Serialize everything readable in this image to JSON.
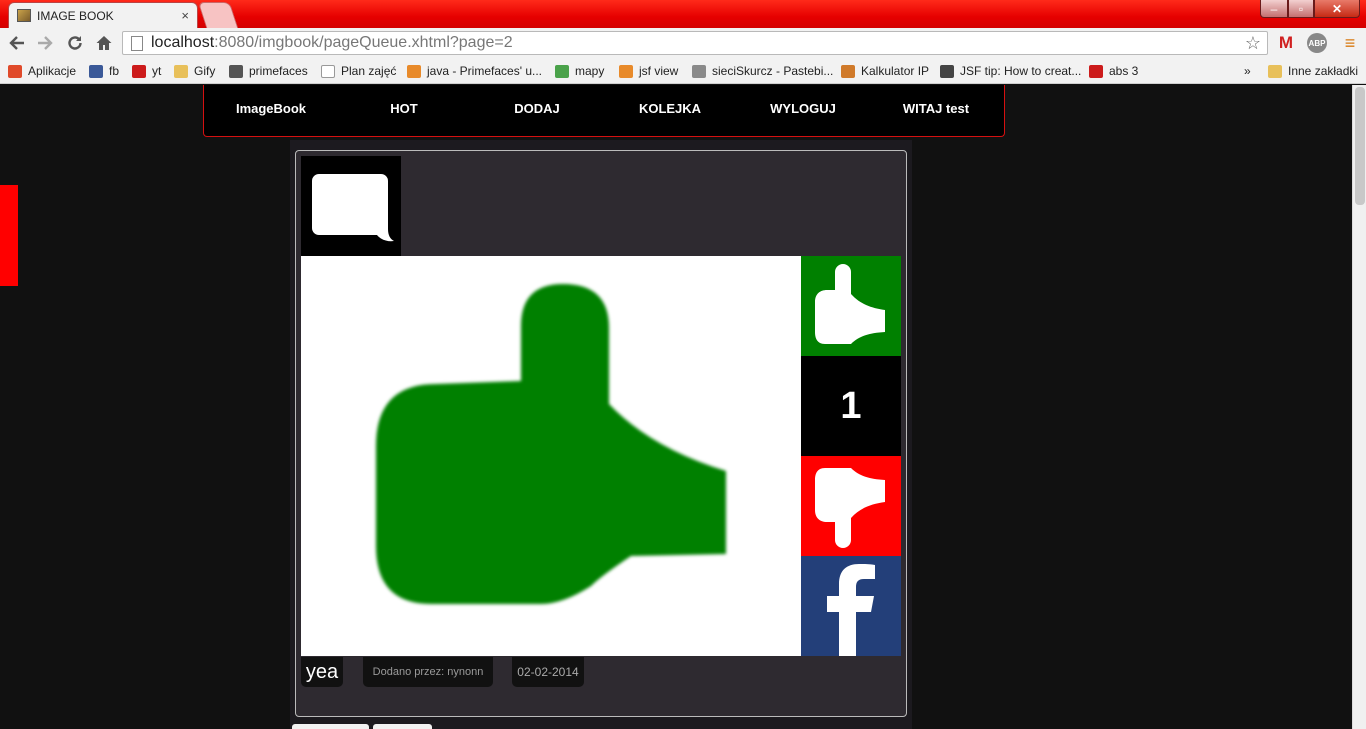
{
  "browser": {
    "tab_title": "IMAGE BOOK",
    "tab_close": "×",
    "url_host": "localhost",
    "url_path": ":8080/imgbook/pageQueue.xhtml?page=2",
    "window_controls": {
      "minimize": "–",
      "maximize": "▫",
      "close": "✕"
    },
    "extensions": {
      "gmail": "M",
      "abp": "ABP"
    },
    "bookmarks": [
      {
        "label": "Aplikacje",
        "icon": "apps-grid-icon",
        "color": "#e04a2a"
      },
      {
        "label": "fb",
        "icon": "facebook-icon",
        "color": "#3b5998"
      },
      {
        "label": "yt",
        "icon": "youtube-icon",
        "color": "#cc1b1b"
      },
      {
        "label": "Gify",
        "icon": "folder-icon",
        "color": "#e8c05a"
      },
      {
        "label": "primefaces",
        "icon": "primefaces-icon",
        "color": "#555555"
      },
      {
        "label": "Plan zajęć",
        "icon": "page-icon",
        "color": "#ffffff"
      },
      {
        "label": "java - Primefaces' u...",
        "icon": "stackoverflow-icon",
        "color": "#e88a2a"
      },
      {
        "label": "mapy",
        "icon": "maps-icon",
        "color": "#4aa24a"
      },
      {
        "label": "jsf view",
        "icon": "stackoverflow-icon",
        "color": "#e88a2a"
      },
      {
        "label": "sieciSkurcz - Pastebi...",
        "icon": "pastebin-icon",
        "color": "#8a8a8a"
      },
      {
        "label": "Kalkulator IP",
        "icon": "network-icon",
        "color": "#d07a2a"
      },
      {
        "label": "JSF tip: How to creat...",
        "icon": "globe-icon",
        "color": "#444444"
      },
      {
        "label": "abs 3",
        "icon": "youtube-icon",
        "color": "#cc1b1b"
      }
    ],
    "bookmarks_overflow": "»",
    "other_bookmarks": "Inne zakładki"
  },
  "nav": {
    "brand": "ImageBook",
    "items": [
      "HOT",
      "DODAJ",
      "KOLEJKA",
      "WYLOGUJ",
      "WITAJ test"
    ]
  },
  "post": {
    "image_icon": "thumbs-up-icon",
    "score": "1",
    "title": "yea",
    "author": "Dodano przez: nynonn",
    "date": "02-02-2014"
  },
  "colors": {
    "brand_red": "#ff0000",
    "like_green": "#008000",
    "facebook_blue": "#233f79"
  }
}
